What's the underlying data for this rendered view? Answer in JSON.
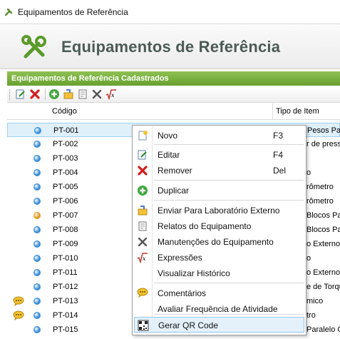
{
  "window": {
    "title": "Equipamentos de Referência"
  },
  "header": {
    "title": "Equipamentos de Referência",
    "logo_icon": "tools-icon"
  },
  "section": {
    "title": "Equipamentos de Referência Cadastrados"
  },
  "toolbar": {
    "buttons": [
      "edit-icon",
      "delete-icon",
      "add-icon",
      "send-lab-icon",
      "report-icon",
      "maintenance-icon",
      "expression-icon"
    ]
  },
  "grid": {
    "columns": {
      "codigo": "Código",
      "tipo": "Tipo de Item"
    },
    "rows": [
      {
        "code": "PT-001",
        "type": "Pesos Pad",
        "status": "blue",
        "comment": false,
        "selected": true
      },
      {
        "code": "PT-002",
        "type": "r de press",
        "status": "blue",
        "comment": false
      },
      {
        "code": "PT-003",
        "type": "",
        "status": "blue",
        "comment": false
      },
      {
        "code": "PT-004",
        "type": "o",
        "status": "blue",
        "comment": false
      },
      {
        "code": "PT-005",
        "type": "rômetro",
        "status": "blue",
        "comment": false
      },
      {
        "code": "PT-006",
        "type": "rômetro",
        "status": "blue",
        "comment": false
      },
      {
        "code": "PT-007",
        "type": "Blocos Pa",
        "status": "orange",
        "comment": false
      },
      {
        "code": "PT-008",
        "type": "Blocos Pa",
        "status": "blue",
        "comment": false
      },
      {
        "code": "PT-009",
        "type": "o Externo",
        "status": "blue",
        "comment": false
      },
      {
        "code": "PT-010",
        "type": "o",
        "status": "blue",
        "comment": false
      },
      {
        "code": "PT-011",
        "type": "o Externo",
        "status": "blue",
        "comment": false
      },
      {
        "code": "PT-012",
        "type": "e de Torqu",
        "status": "blue",
        "comment": false
      },
      {
        "code": "PT-013",
        "type": "mico",
        "status": "blue",
        "comment": true
      },
      {
        "code": "PT-014",
        "type": "tro",
        "status": "blue",
        "comment": true
      },
      {
        "code": "PT-015",
        "type": "Paralelo O",
        "status": "blue",
        "comment": false
      }
    ]
  },
  "context_menu": {
    "items": [
      {
        "label": "Novo",
        "shortcut": "F3",
        "icon": "new-icon"
      },
      {
        "separator": true
      },
      {
        "label": "Editar",
        "shortcut": "F4",
        "icon": "edit-icon"
      },
      {
        "label": "Remover",
        "shortcut": "Del",
        "icon": "delete-icon"
      },
      {
        "separator": true
      },
      {
        "label": "Duplicar",
        "shortcut": "",
        "icon": "duplicate-icon"
      },
      {
        "separator": true
      },
      {
        "label": "Enviar Para Laboratório Externo",
        "shortcut": "",
        "icon": "send-lab-icon"
      },
      {
        "label": "Relatos do Equipamento",
        "shortcut": "",
        "icon": "report-icon"
      },
      {
        "label": "Manutenções do Equipamento",
        "shortcut": "",
        "icon": "maintenance-icon"
      },
      {
        "label": "Expressões",
        "shortcut": "",
        "icon": "expression-icon"
      },
      {
        "label": "Visualizar Histórico",
        "shortcut": "",
        "icon": ""
      },
      {
        "separator": true
      },
      {
        "label": "Comentários",
        "shortcut": "",
        "icon": "comment-icon"
      },
      {
        "label": "Avaliar Frequência de Atividade",
        "shortcut": "",
        "icon": ""
      },
      {
        "separator": true
      },
      {
        "label": "Gerar QR Code",
        "shortcut": "",
        "icon": "qr-code-icon",
        "hover": true
      }
    ]
  },
  "colors": {
    "accent_green": "#68a02e",
    "status_blue": "#3b8fd9",
    "status_orange": "#e59a1c",
    "hover_blue": "#e4f1fb"
  }
}
